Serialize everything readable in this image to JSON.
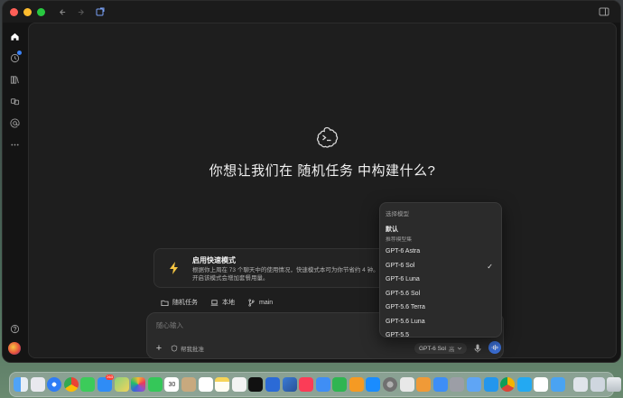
{
  "hero": {
    "title": "你想让我们在 随机任务 中构建什么?"
  },
  "speed_card": {
    "title": "启用快速模式",
    "description": "根据你上周在 73 个聊天中的使用情况，快速模式本可为你节省约 4 钟。开启该模式会增加套餐用量。"
  },
  "context": {
    "project": "随机任务",
    "environment": "本地",
    "branch": "main"
  },
  "composer": {
    "placeholder": "随心输入",
    "approval_label": "帮我批准",
    "model": "GPT-6 Sol",
    "speed": "高"
  },
  "model_menu": {
    "header": "选择模型",
    "default_label": "默认",
    "default_sub": "推荐模型集",
    "items": [
      "GPT-6 Astra",
      "GPT-6 Sol",
      "GPT-6 Luna",
      "GPT-5.6 Sol",
      "GPT-5.6 Terra",
      "GPT-5.6 Luna",
      "GPT-5.5"
    ],
    "selected": "GPT-6 Sol"
  },
  "dock": {
    "mail_badge": "263",
    "calendar_day": "30"
  },
  "colors": {
    "accent": "#3b6fd6",
    "background": "#1e1e1e",
    "window": "#141414"
  }
}
